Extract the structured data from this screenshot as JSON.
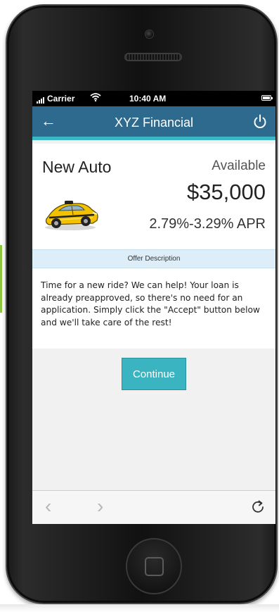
{
  "status_bar": {
    "carrier": "Carrier",
    "time": "10:40 AM"
  },
  "app_bar": {
    "back_icon": "arrow-left-icon",
    "title": "XYZ Financial",
    "power_icon": "power-icon"
  },
  "offer": {
    "name": "New Auto",
    "available_label": "Available",
    "amount": "$35,000",
    "apr": "2.79%-3.29% APR",
    "image_icon": "yellow-taxi-car-icon"
  },
  "description": {
    "header": "Offer Description",
    "body": "Time for a new ride? We can help! Your loan is already preapproved, so there's no need for an application. Simply click the \"Accept\" button below and we'll take care of the rest!"
  },
  "actions": {
    "continue_label": "Continue"
  },
  "browser_bar": {
    "back_glyph": "‹",
    "forward_glyph": "›",
    "refresh_icon": "refresh-icon"
  },
  "colors": {
    "app_bar": "#2d6a8e",
    "accent": "#3ab7c4",
    "button": "#3bb4c2",
    "desc_header_bg": "#ddeef9"
  }
}
